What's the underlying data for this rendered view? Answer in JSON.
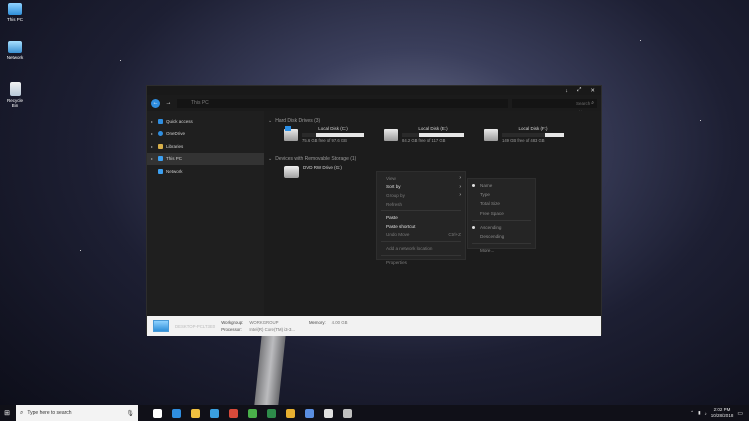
{
  "desktop": {
    "icons": [
      {
        "label": "This PC"
      },
      {
        "label": "Network"
      },
      {
        "label": "Recycle Bin"
      }
    ]
  },
  "window": {
    "controls": {
      "download": "↓",
      "maximize": "⤢",
      "close": "✕"
    },
    "nav": {
      "back": "←",
      "forward": "→"
    },
    "address": "This PC",
    "search_placeholder": "Search This PC",
    "sidebar": [
      {
        "label": "Quick access",
        "color": "#2f8ee0"
      },
      {
        "label": "OneDrive",
        "color": "#2f8ee0"
      },
      {
        "label": "Libraries",
        "color": "#d8b04a"
      },
      {
        "label": "This PC",
        "color": "#3da0f0"
      },
      {
        "label": "Network",
        "color": "#3da0f0"
      }
    ],
    "groups": {
      "hard_disks": "Hard Disk Drives (3)",
      "removable": "Devices with Removable Storage (1)"
    },
    "drives": [
      {
        "name": "Local Disk (C:)",
        "free": "75.6 GB free of 97.6 GB",
        "used_fraction": 0.23
      },
      {
        "name": "Local Disk (E:)",
        "free": "84.2 GB free of 117 GB",
        "used_fraction": 0.28
      },
      {
        "name": "Local Disk (F:)",
        "free": "149 GB free of 483 GB",
        "used_fraction": 0.69
      }
    ],
    "dvd": {
      "name": "DVD RW Drive (G:)"
    },
    "details": {
      "computer": "DESKTOP-PCLT3E0",
      "workgroup_label": "Workgroup:",
      "workgroup_value": "WORKGROUP",
      "memory_label": "Memory:",
      "memory_value": "4.00 GB",
      "processor_label": "Processor:",
      "processor_value": "Intel(R) Core(TM) i3-3..."
    }
  },
  "context_menu": {
    "items": [
      {
        "label": "View",
        "enabled": false,
        "submenu": true
      },
      {
        "label": "Sort by",
        "enabled": true,
        "submenu": true
      },
      {
        "label": "Group by",
        "enabled": false,
        "submenu": true
      },
      {
        "label": "Refresh",
        "enabled": false
      }
    ],
    "items2": [
      {
        "label": "Paste",
        "enabled": true
      },
      {
        "label": "Paste shortcut",
        "enabled": true
      },
      {
        "label": "Undo Move",
        "enabled": false,
        "shortcut": "Ctrl+Z"
      }
    ],
    "items3": [
      {
        "label": "Add a network location",
        "enabled": false
      }
    ],
    "items4": [
      {
        "label": "Properties",
        "enabled": false
      }
    ]
  },
  "sort_submenu": {
    "items": [
      "Name",
      "Type",
      "Total Size",
      "Free Space"
    ],
    "order": [
      "Ascending",
      "Descending"
    ],
    "more": "More...",
    "selected_item": "Name",
    "selected_order": "Ascending"
  },
  "taskbar": {
    "start": "⊞",
    "search_placeholder": "Type here to search",
    "mic": "🎤",
    "clock_time": "2:02 PM",
    "clock_date": "10/28/2018",
    "pinned": [
      {
        "name": "task-view",
        "color": "#ffffff"
      },
      {
        "name": "edge",
        "color": "#2f8ee0"
      },
      {
        "name": "file-explorer",
        "color": "#f0c040"
      },
      {
        "name": "telegram",
        "color": "#3aa0e0"
      },
      {
        "name": "app-red",
        "color": "#d84a3a"
      },
      {
        "name": "app-green",
        "color": "#4ab04a"
      },
      {
        "name": "app-excel",
        "color": "#2e8b4a"
      },
      {
        "name": "chrome",
        "color": "#e8b030"
      },
      {
        "name": "app-blue",
        "color": "#5a8ee0"
      },
      {
        "name": "settings",
        "color": "#e0e0e0"
      },
      {
        "name": "app-gray",
        "color": "#c0c0c0"
      }
    ]
  }
}
